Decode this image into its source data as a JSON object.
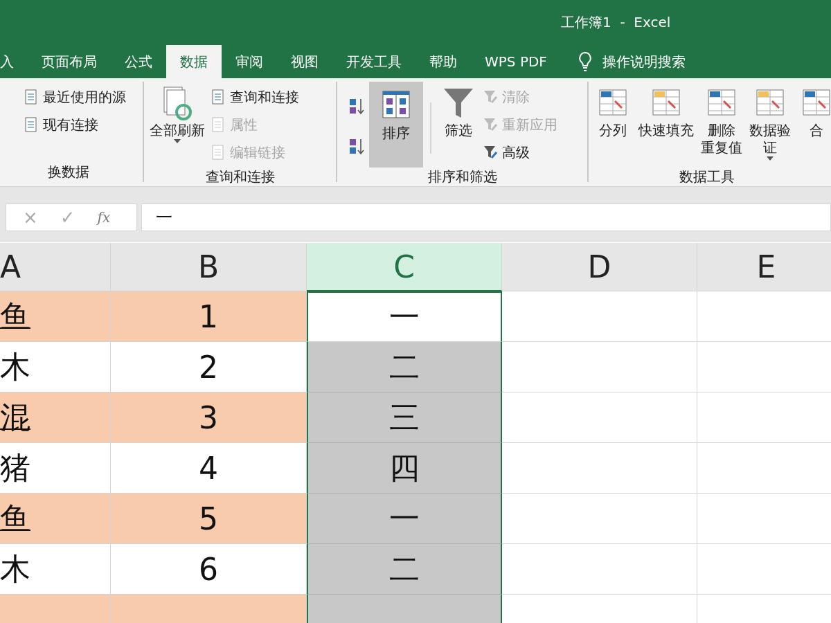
{
  "title_bar": {
    "title": "工作簿1  -  Excel"
  },
  "tabs": [
    {
      "label": "入",
      "selected": false
    },
    {
      "label": "页面布局",
      "selected": false
    },
    {
      "label": "公式",
      "selected": false
    },
    {
      "label": "数据",
      "selected": true
    },
    {
      "label": "审阅",
      "selected": false
    },
    {
      "label": "视图",
      "selected": false
    },
    {
      "label": "开发工具",
      "selected": false
    },
    {
      "label": "帮助",
      "selected": false
    },
    {
      "label": "WPS PDF",
      "selected": false
    }
  ],
  "tell_me": {
    "label": "操作说明搜索"
  },
  "ribbon": {
    "groups": [
      {
        "label": "换数据",
        "columns": [
          {
            "kind": "stack",
            "items": [
              {
                "label": "最近使用的源",
                "disabled": false
              },
              {
                "label": "现有连接",
                "disabled": false
              }
            ]
          }
        ]
      },
      {
        "label": "查询和连接",
        "columns": [
          {
            "kind": "large",
            "label": "全部刷新",
            "dropdown": true,
            "pressed": false
          },
          {
            "kind": "stack",
            "items": [
              {
                "label": "查询和连接",
                "disabled": false
              },
              {
                "label": "属性",
                "disabled": true
              },
              {
                "label": "编辑链接",
                "disabled": true
              }
            ]
          }
        ]
      },
      {
        "label": "排序和筛选",
        "columns": [
          {
            "kind": "icons"
          },
          {
            "kind": "large",
            "label": "排序",
            "dropdown": false,
            "pressed": true
          },
          {
            "kind": "divider"
          },
          {
            "kind": "large",
            "label": "筛选",
            "dropdown": false,
            "pressed": false
          },
          {
            "kind": "stack",
            "items": [
              {
                "label": "清除",
                "disabled": true
              },
              {
                "label": "重新应用",
                "disabled": true
              },
              {
                "label": "高级",
                "disabled": false
              }
            ]
          }
        ]
      },
      {
        "label": "数据工具",
        "columns": [
          {
            "kind": "large",
            "label": "分列",
            "dropdown": false,
            "pressed": false
          },
          {
            "kind": "large",
            "label": "快速填充",
            "dropdown": false,
            "pressed": false
          },
          {
            "kind": "large",
            "lines": [
              "删除",
              "重复值"
            ],
            "dropdown": false,
            "pressed": false
          },
          {
            "kind": "large",
            "lines": [
              "数据验",
              "证"
            ],
            "dropdown": true,
            "pressed": false
          },
          {
            "kind": "large",
            "label": "合",
            "dropdown": false,
            "pressed": false
          }
        ]
      }
    ]
  },
  "formula_bar": {
    "buttons": [
      "×",
      "✓",
      "fx"
    ],
    "value": "一"
  },
  "sheet": {
    "columns": [
      {
        "label": "A",
        "selected": false
      },
      {
        "label": "B",
        "selected": false
      },
      {
        "label": "C",
        "selected": true
      },
      {
        "label": "D",
        "selected": false
      },
      {
        "label": "E",
        "selected": false
      }
    ],
    "rows": [
      {
        "a": "鱼",
        "b": "1",
        "c": "一",
        "shaded": true,
        "selected": true,
        "active": true
      },
      {
        "a": "木",
        "b": "2",
        "c": "二",
        "shaded": false,
        "selected": true,
        "active": false
      },
      {
        "a": "混",
        "b": "3",
        "c": "三",
        "shaded": true,
        "selected": true,
        "active": false
      },
      {
        "a": "猪",
        "b": "4",
        "c": "四",
        "shaded": false,
        "selected": true,
        "active": false
      },
      {
        "a": "鱼",
        "b": "5",
        "c": "一",
        "shaded": true,
        "selected": true,
        "active": false
      },
      {
        "a": "木",
        "b": "6",
        "c": "二",
        "shaded": false,
        "selected": true,
        "active": false
      },
      {
        "shaded": true,
        "selected": true,
        "active": false
      }
    ]
  }
}
